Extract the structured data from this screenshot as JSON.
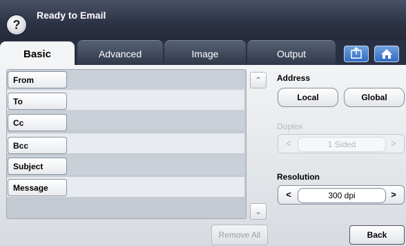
{
  "header": {
    "status": "Ready to Email",
    "help_icon": "?"
  },
  "tabs": [
    "Basic",
    "Advanced",
    "Image",
    "Output"
  ],
  "toolbar": {
    "job_status_icon": "job-status-icon",
    "home_icon": "home-icon"
  },
  "fields": [
    {
      "label": "From",
      "value": ""
    },
    {
      "label": "To",
      "value": ""
    },
    {
      "label": "Cc",
      "value": ""
    },
    {
      "label": "Bcc",
      "value": ""
    },
    {
      "label": "Subject",
      "value": ""
    },
    {
      "label": "Message",
      "value": ""
    }
  ],
  "list": {
    "remove_all": "Remove All"
  },
  "address": {
    "label": "Address",
    "local": "Local",
    "global": "Global"
  },
  "duplex": {
    "label": "Duplex",
    "value": "1 Sided"
  },
  "resolution": {
    "label": "Resolution",
    "value": "300 dpi"
  },
  "actions": {
    "back": "Back"
  }
}
